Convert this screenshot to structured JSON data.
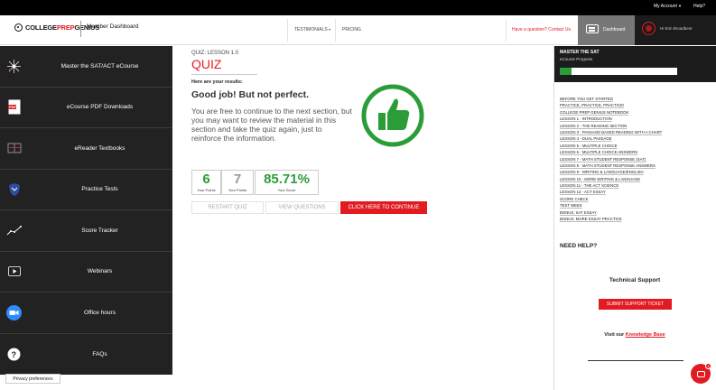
{
  "topbar": {
    "account": "My Account",
    "help": "Help?"
  },
  "header": {
    "logo_a": "COLLEGE",
    "logo_b": "PREP",
    "logo_c": "GENIUS",
    "title": "Member Dashboard",
    "nav": [
      {
        "label": "TESTIMONIALS"
      },
      {
        "label": "PRICING"
      }
    ],
    "contact": "Have a question? Contact Us.",
    "dashboard": "Dashboard",
    "user": "Hi Erin Broadbent"
  },
  "sidebar": {
    "items": [
      {
        "label": "Master the SAT/ACT eCourse",
        "icon": "constellation-icon"
      },
      {
        "label": "eCourse PDF Downloads",
        "icon": "pdf-icon"
      },
      {
        "label": "eReader Textbooks",
        "icon": "book-icon"
      },
      {
        "label": "Practice Tests",
        "icon": "shield-icon"
      },
      {
        "label": "Score Tracker",
        "icon": "chart-line-icon"
      },
      {
        "label": "Webinars",
        "icon": "play-icon"
      },
      {
        "label": "Office hours",
        "icon": "video-camera-icon"
      },
      {
        "label": "FAQs",
        "icon": "question-icon"
      }
    ]
  },
  "privacy": "Privacy preferences",
  "quiz": {
    "subtitle": "QUIZ: LESSON 1.0",
    "title": "QUIZ",
    "results_label": "Here are your results:",
    "headline": "Good job! But not perfect.",
    "body": "You are free to continue to the next section, but you may want to review the material in this section and take the quiz again, just to reinforce the information.",
    "scores": {
      "your_points": "6",
      "your_points_label": "Your Points",
      "total_points": "7",
      "total_points_label": "Your Points",
      "score": "85.71%",
      "score_label": "Your Score"
    },
    "buttons": {
      "restart": "RESTART QUIZ",
      "view": "VIEW QUESTIONS",
      "continue": "CLICK HERE TO CONTINUE"
    }
  },
  "progress": {
    "title": "MASTER THE SAT",
    "subtitle": "eCourse Progress",
    "fraction": 0.1
  },
  "lessons": [
    "BEFORE YOU GET STARTED",
    "PRACTICE, PRACTICE, PRACTICE!",
    "COLLEGE PREP GENIUS NOTEBOOK",
    "LESSON 1 - INTRODUCTION",
    "LESSON 2 - THE READING SECTION",
    "LESSON 3 - PASSAGE BASED READING WITH A CHART",
    "LESSON 4 - DUAL PASSAGE",
    "LESSON 5 - MULTIPLE CHOICE",
    "LESSON 6 - MULTIPLE CHOICE ANSWERS",
    "LESSON 7 - MATH STUDENT RESPONSE (SAT)",
    "LESSON 8 - MATH STUDENT RESPONSE ANSWERS",
    "LESSON 9 - WRITING & LANGUAGE/ENGLISH",
    "LESSON 10 - MORE WRITING & LANGUAGE",
    "LESSON 11 - THE ACT SCIENCE",
    "LESSON 12 - ACT ESSAY",
    "SCORE CHECK",
    "TEST WEEK",
    "BONUS: SAT ESSAY",
    "BONUS: MORE ESSAY PRACTICE"
  ],
  "help": {
    "title": "NEED HELP?",
    "tech": "Technical Support",
    "ticket": "SUBMIT SUPPORT TICKET",
    "visit": "Visit our",
    "kb": "Knowledge Base"
  },
  "chat": {
    "badge": "1"
  },
  "colors": {
    "accent": "#e21b23",
    "success": "#2a9d38",
    "sidebar": "#222222"
  }
}
